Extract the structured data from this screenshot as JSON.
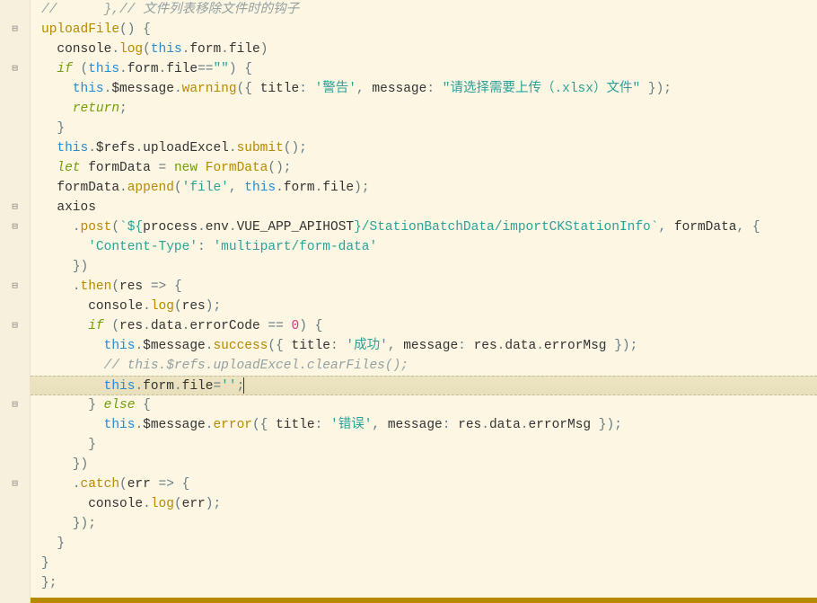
{
  "lines": [
    {
      "fold": "",
      "cls": "",
      "html": "<span class='c-comment'>//      },// 文件列表移除文件时的钩子</span>"
    },
    {
      "fold": "⊟",
      "cls": "",
      "html": "<span class='c-func'>uploadFile</span><span class='c-punc'>() {</span>"
    },
    {
      "fold": "",
      "cls": "",
      "html": "  <span class='c-ident'>console</span><span class='c-punc'>.</span><span class='c-func'>log</span><span class='c-punc'>(</span><span class='c-this'>this</span><span class='c-punc'>.</span><span class='c-prop'>form</span><span class='c-punc'>.</span><span class='c-prop'>file</span><span class='c-punc'>)</span>"
    },
    {
      "fold": "⊟",
      "cls": "",
      "html": "  <span class='c-keyword'>if</span> <span class='c-punc'>(</span><span class='c-this'>this</span><span class='c-punc'>.</span><span class='c-prop'>form</span><span class='c-punc'>.</span><span class='c-prop'>file</span><span class='c-op'>==</span><span class='c-string'>\"\"</span><span class='c-punc'>) {</span>"
    },
    {
      "fold": "",
      "cls": "",
      "html": "    <span class='c-this'>this</span><span class='c-punc'>.</span><span class='c-prop'>$message</span><span class='c-punc'>.</span><span class='c-func'>warning</span><span class='c-punc'>({ </span><span class='c-prop'>title</span><span class='c-punc'>: </span><span class='c-string'>'警告'</span><span class='c-punc'>, </span><span class='c-prop'>message</span><span class='c-punc'>: </span><span class='c-string'>\"请选择需要上传（.xlsx）文件\"</span><span class='c-punc'> });</span>"
    },
    {
      "fold": "",
      "cls": "",
      "html": "    <span class='c-keyword'>return</span><span class='c-punc'>;</span>"
    },
    {
      "fold": "",
      "cls": "",
      "html": "  <span class='c-punc'>}</span>"
    },
    {
      "fold": "",
      "cls": "",
      "html": "  <span class='c-this'>this</span><span class='c-punc'>.</span><span class='c-prop'>$refs</span><span class='c-punc'>.</span><span class='c-prop'>uploadExcel</span><span class='c-punc'>.</span><span class='c-func'>submit</span><span class='c-punc'>();</span>"
    },
    {
      "fold": "",
      "cls": "",
      "html": "  <span class='c-keyword'>let</span> <span class='c-ident'>formData</span> <span class='c-op'>=</span> <span class='c-new'>new</span> <span class='c-type'>FormData</span><span class='c-punc'>();</span>"
    },
    {
      "fold": "",
      "cls": "",
      "html": "  <span class='c-ident'>formData</span><span class='c-punc'>.</span><span class='c-func'>append</span><span class='c-punc'>(</span><span class='c-string'>'file'</span><span class='c-punc'>, </span><span class='c-this'>this</span><span class='c-punc'>.</span><span class='c-prop'>form</span><span class='c-punc'>.</span><span class='c-prop'>file</span><span class='c-punc'>);</span>"
    },
    {
      "fold": "⊟",
      "cls": "",
      "html": "  <span class='c-ident'>axios</span>"
    },
    {
      "fold": "⊟",
      "cls": "",
      "html": "    <span class='c-punc'>.</span><span class='c-func'>post</span><span class='c-punc'>(</span><span class='c-string'>`${</span><span class='c-ident'>process</span><span class='c-punc'>.</span><span class='c-prop'>env</span><span class='c-punc'>.</span><span class='c-prop'>VUE_APP_APIHOST</span><span class='c-string'>}/StationBatchData/importCKStationInfo`</span><span class='c-punc'>, </span><span class='c-ident'>formData</span><span class='c-punc'>, {</span>"
    },
    {
      "fold": "",
      "cls": "",
      "html": "      <span class='c-string'>'Content-Type'</span><span class='c-punc'>: </span><span class='c-string'>'multipart/form-data'</span>"
    },
    {
      "fold": "",
      "cls": "",
      "html": "    <span class='c-punc'>})</span>"
    },
    {
      "fold": "⊟",
      "cls": "",
      "html": "    <span class='c-punc'>.</span><span class='c-func'>then</span><span class='c-punc'>(</span><span class='c-ident'>res</span> <span class='c-arrow'>=&gt;</span> <span class='c-punc'>{</span>"
    },
    {
      "fold": "",
      "cls": "",
      "html": "      <span class='c-ident'>console</span><span class='c-punc'>.</span><span class='c-func'>log</span><span class='c-punc'>(</span><span class='c-ident'>res</span><span class='c-punc'>);</span>"
    },
    {
      "fold": "⊟",
      "cls": "",
      "html": "      <span class='c-keyword'>if</span> <span class='c-punc'>(</span><span class='c-ident'>res</span><span class='c-punc'>.</span><span class='c-prop'>data</span><span class='c-punc'>.</span><span class='c-prop'>errorCode</span> <span class='c-op'>==</span> <span class='c-num'>0</span><span class='c-punc'>) {</span>"
    },
    {
      "fold": "",
      "cls": "",
      "html": "        <span class='c-this'>this</span><span class='c-punc'>.</span><span class='c-prop'>$message</span><span class='c-punc'>.</span><span class='c-func'>success</span><span class='c-punc'>({ </span><span class='c-prop'>title</span><span class='c-punc'>: </span><span class='c-string'>'成功'</span><span class='c-punc'>, </span><span class='c-prop'>message</span><span class='c-punc'>: </span><span class='c-ident'>res</span><span class='c-punc'>.</span><span class='c-prop'>data</span><span class='c-punc'>.</span><span class='c-prop'>errorMsg</span><span class='c-punc'> });</span>"
    },
    {
      "fold": "",
      "cls": "",
      "html": "        <span class='c-comment'>// this.$refs.uploadExcel.clearFiles();</span>"
    },
    {
      "fold": "",
      "cls": "highlight",
      "html": "        <span class='c-this'>this</span><span class='c-punc'>.</span><span class='c-prop'>form</span><span class='c-punc'>.</span><span class='c-prop'>file</span><span class='c-op'>=</span><span class='c-string'>''</span><span class='c-punc'>;</span><span class='cursor'></span>"
    },
    {
      "fold": "⊟",
      "cls": "",
      "html": "      <span class='c-punc'>}</span> <span class='c-keyword'>else</span> <span class='c-punc'>{</span>"
    },
    {
      "fold": "",
      "cls": "",
      "html": "        <span class='c-this'>this</span><span class='c-punc'>.</span><span class='c-prop'>$message</span><span class='c-punc'>.</span><span class='c-func'>error</span><span class='c-punc'>({ </span><span class='c-prop'>title</span><span class='c-punc'>: </span><span class='c-string'>'错误'</span><span class='c-punc'>, </span><span class='c-prop'>message</span><span class='c-punc'>: </span><span class='c-ident'>res</span><span class='c-punc'>.</span><span class='c-prop'>data</span><span class='c-punc'>.</span><span class='c-prop'>errorMsg</span><span class='c-punc'> });</span>"
    },
    {
      "fold": "",
      "cls": "",
      "html": "      <span class='c-punc'>}</span>"
    },
    {
      "fold": "",
      "cls": "",
      "html": "    <span class='c-punc'>})</span>"
    },
    {
      "fold": "⊟",
      "cls": "",
      "html": "    <span class='c-punc'>.</span><span class='c-func'>catch</span><span class='c-punc'>(</span><span class='c-ident'>err</span> <span class='c-arrow'>=&gt;</span> <span class='c-punc'>{</span>"
    },
    {
      "fold": "",
      "cls": "",
      "html": "      <span class='c-ident'>console</span><span class='c-punc'>.</span><span class='c-func'>log</span><span class='c-punc'>(</span><span class='c-ident'>err</span><span class='c-punc'>);</span>"
    },
    {
      "fold": "",
      "cls": "",
      "html": "    <span class='c-punc'>});</span>"
    },
    {
      "fold": "",
      "cls": "",
      "html": "  <span class='c-punc'>}</span>"
    },
    {
      "fold": "",
      "cls": "",
      "html": "<span class='c-punc'>}</span>"
    },
    {
      "fold": "",
      "cls": "",
      "html": "<span class='c-punc'>};</span>"
    }
  ]
}
